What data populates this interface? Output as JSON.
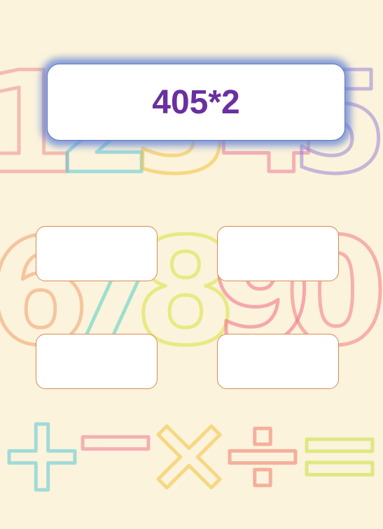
{
  "question": {
    "expression": "405*2"
  },
  "answers": [
    "",
    "",
    "",
    ""
  ],
  "background": {
    "glyphs": [
      {
        "char": "1",
        "color": "#f08f8f"
      },
      {
        "char": "2",
        "color": "#58c9d6"
      },
      {
        "char": "3",
        "color": "#f3c23a"
      },
      {
        "char": "4",
        "color": "#f07a92"
      },
      {
        "char": "5",
        "color": "#9a84d4"
      },
      {
        "char": "6",
        "color": "#f3a06a"
      },
      {
        "char": "7",
        "color": "#52cfc4"
      },
      {
        "char": "8",
        "color": "#d8e33a"
      },
      {
        "char": "9",
        "color": "#f26a86"
      },
      {
        "char": "0",
        "color": "#f27a84"
      },
      {
        "char": "+",
        "color": "#58c9d6"
      },
      {
        "char": "−",
        "color": "#f07a92"
      },
      {
        "char": "×",
        "color": "#f3c23a"
      },
      {
        "char": "÷",
        "color": "#f07a6a"
      },
      {
        "char": "=",
        "color": "#c8e03a"
      }
    ]
  },
  "colors": {
    "question_text": "#6a2fa0",
    "question_glow": "#6080d4",
    "answer_border": "#d98a55",
    "page_bg": "#fbf3dc"
  }
}
